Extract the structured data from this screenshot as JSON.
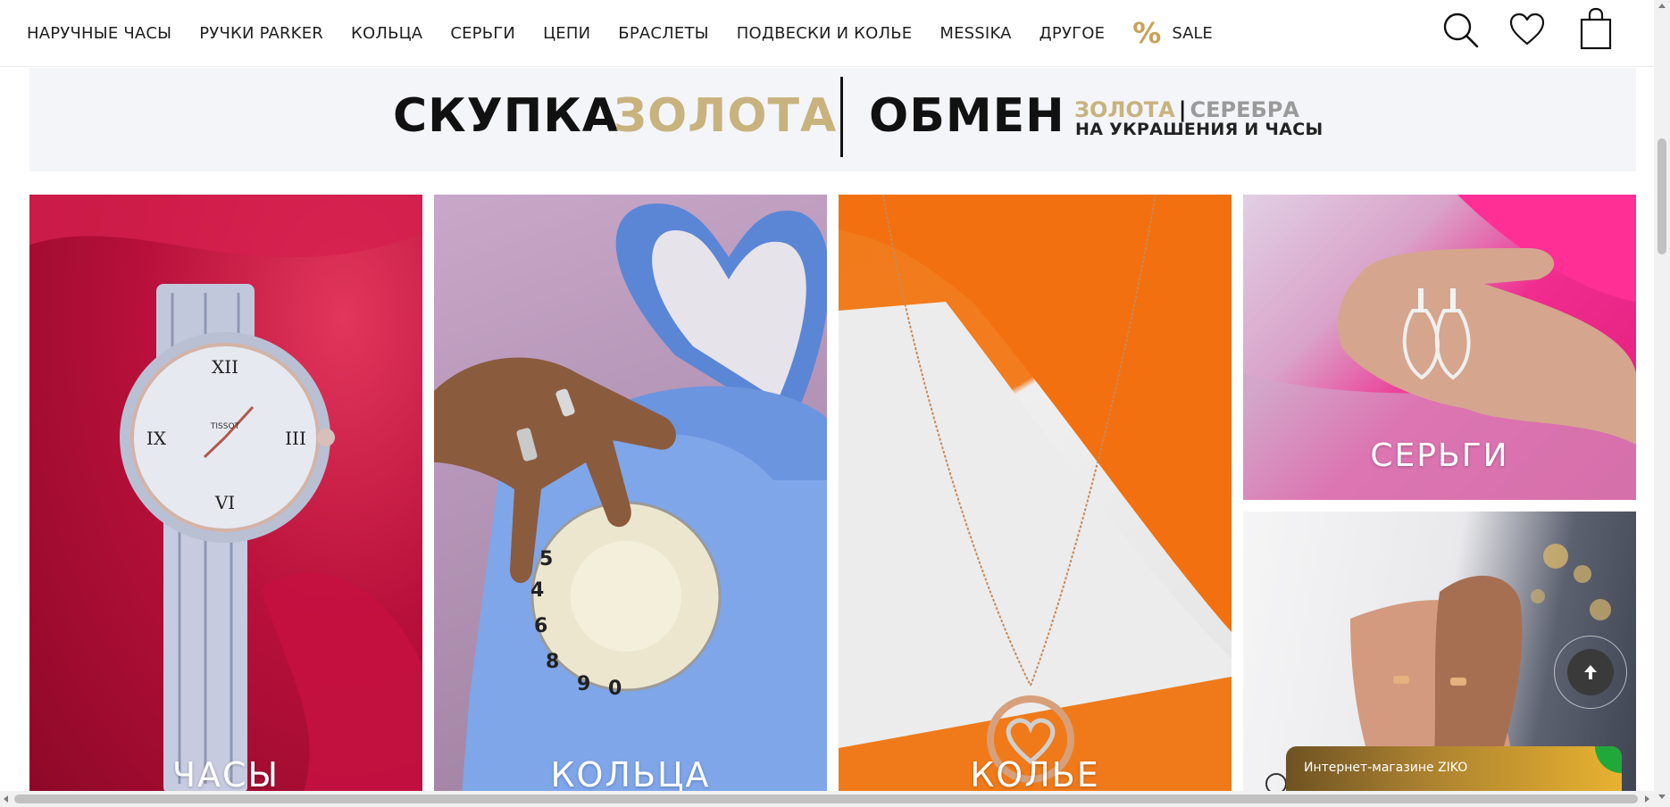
{
  "nav": {
    "items": [
      {
        "label": "НАРУЧНЫЕ ЧАСЫ"
      },
      {
        "label": "РУЧКИ PARKER"
      },
      {
        "label": "КОЛЬЦА"
      },
      {
        "label": "СЕРЬГИ"
      },
      {
        "label": "ЦЕПИ"
      },
      {
        "label": "БРАСЛЕТЫ"
      },
      {
        "label": "ПОДВЕСКИ И КОЛЬЕ"
      },
      {
        "label": "MESSIKA"
      },
      {
        "label": "ДРУГОЕ"
      }
    ],
    "sale": {
      "icon": "%",
      "label": "SALE"
    },
    "icons": [
      "search-icon",
      "heart-icon",
      "shopping-bag-icon"
    ]
  },
  "banner": {
    "word1": "СКУПКА",
    "word2": "ЗОЛОТА",
    "word3": "ОБМЕН",
    "sub_gold": "ЗОЛОТА",
    "sub_sep": "|",
    "sub_silver": "СЕРЕБРА",
    "sub_line2": "НА УКРАШЕНИЯ И ЧАСЫ"
  },
  "tiles": {
    "watches": "ЧАСЫ",
    "rings": "КОЛЬЦА",
    "necklace": "КОЛЬЕ",
    "earrings": "СЕРЬГИ"
  },
  "chat": {
    "label": "Интернет-магазине ZIKO"
  },
  "colors": {
    "gold": "#c8b27e",
    "sale_accent": "#c9a15a",
    "banner_bg": "#f4f5f9",
    "chat_green": "#21a83a"
  }
}
